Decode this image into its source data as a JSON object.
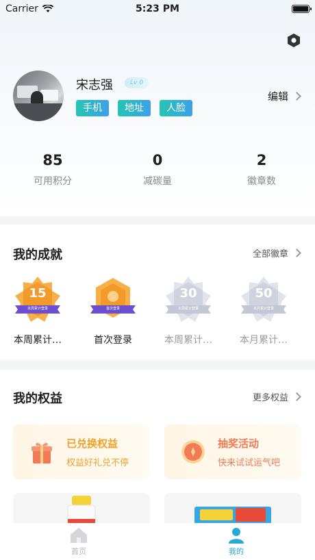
{
  "status_bar": {
    "carrier": "Carrier",
    "time": "5:23 PM"
  },
  "profile": {
    "name": "宋志强",
    "level": "Lv 0",
    "tags": [
      "手机",
      "地址",
      "人脸"
    ],
    "edit_label": "编辑"
  },
  "stats": [
    {
      "value": "85",
      "label": "可用积分"
    },
    {
      "value": "0",
      "label": "减碳量"
    },
    {
      "value": "2",
      "label": "徽章数"
    }
  ],
  "achievements": {
    "title": "我的成就",
    "link": "全部徽章",
    "badges": [
      {
        "label": "本周累计…",
        "number": "15",
        "ribbon": "本周累计登录",
        "earned": true
      },
      {
        "label": "首次登录",
        "number": "",
        "ribbon": "首次登录",
        "earned": true
      },
      {
        "label": "本周累计…",
        "number": "30",
        "ribbon": "本周累计登录",
        "earned": false
      },
      {
        "label": "本月累计…",
        "number": "50",
        "ribbon": "本月累计登录",
        "earned": false
      }
    ]
  },
  "benefits": {
    "title": "我的权益",
    "link": "更多权益",
    "cards": [
      {
        "title": "已兑换权益",
        "subtitle": "权益好礼兑不停",
        "icon": "gift-icon"
      },
      {
        "title": "抽奖活动",
        "subtitle": "快来试试运气吧",
        "icon": "lottery-icon"
      }
    ]
  },
  "tabbar": {
    "items": [
      {
        "label": "首页",
        "icon": "home-icon",
        "active": false
      },
      {
        "label": "我的",
        "icon": "user-icon",
        "active": true
      }
    ]
  },
  "colors": {
    "accent": "#27a9d8",
    "tag_gradient_start": "#25c5b1",
    "tag_gradient_end": "#3fa0e8",
    "benefit_text": "#f0a22b",
    "badge_orange": "#f39a2a",
    "badge_purple": "#6a4fd0"
  }
}
